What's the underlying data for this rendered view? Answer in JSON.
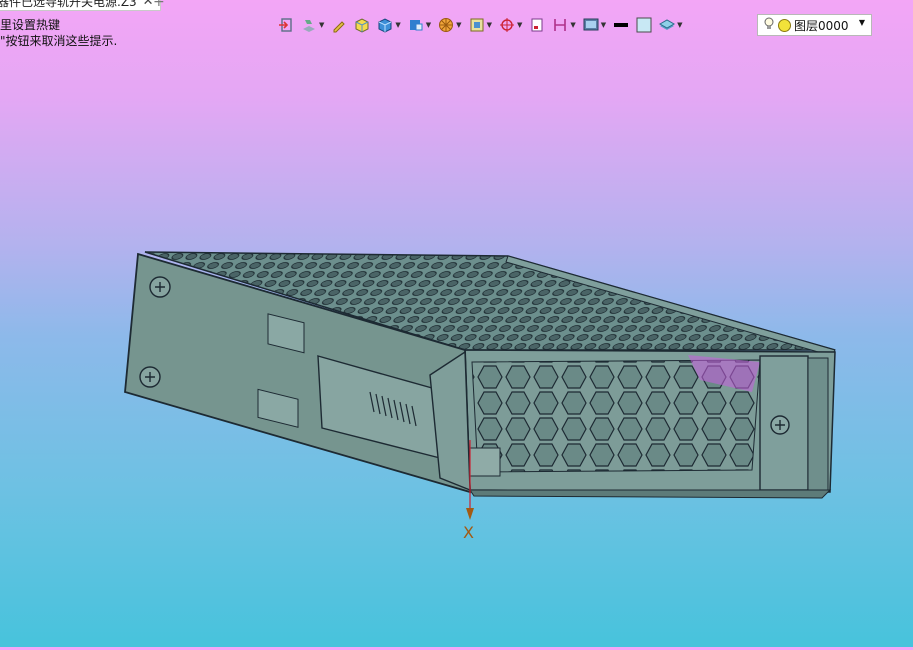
{
  "tab": {
    "title": "器件已选导轨开关电源.Z3",
    "close": "✕",
    "add": "+"
  },
  "tips": {
    "line1": "里设置热键",
    "line2": "\"按钮来取消这些提示."
  },
  "toolbar": {
    "items": [
      {
        "icon": "exit-icon",
        "dropdown": false
      },
      {
        "icon": "render-mode-icon",
        "dropdown": true
      },
      {
        "icon": "pencil-icon",
        "dropdown": false
      },
      {
        "icon": "shaded-box-icon",
        "dropdown": false
      },
      {
        "icon": "blue-cube-icon",
        "dropdown": true
      },
      {
        "icon": "view-cube-icon",
        "dropdown": true
      },
      {
        "icon": "wheel-icon",
        "dropdown": true
      },
      {
        "icon": "frame-icon",
        "dropdown": true
      },
      {
        "icon": "pivot-icon",
        "dropdown": true
      },
      {
        "icon": "page-icon",
        "dropdown": false
      },
      {
        "icon": "section-icon",
        "dropdown": true
      },
      {
        "icon": "display-filter-icon",
        "dropdown": true
      },
      {
        "icon": "line-color-icon",
        "dropdown": false
      },
      {
        "icon": "fill-color-icon",
        "dropdown": false
      },
      {
        "icon": "layer-stack-icon",
        "dropdown": true
      }
    ],
    "colors": {
      "line": "#000000",
      "fill": "#c8e8f4"
    }
  },
  "layer": {
    "value": "图层0000",
    "arrow": "▼"
  },
  "viewport": {
    "axis_label": "X",
    "model_colors": {
      "body": "#6f8f8c",
      "edge": "#1d2a33",
      "accent": "#c85fe0"
    }
  }
}
